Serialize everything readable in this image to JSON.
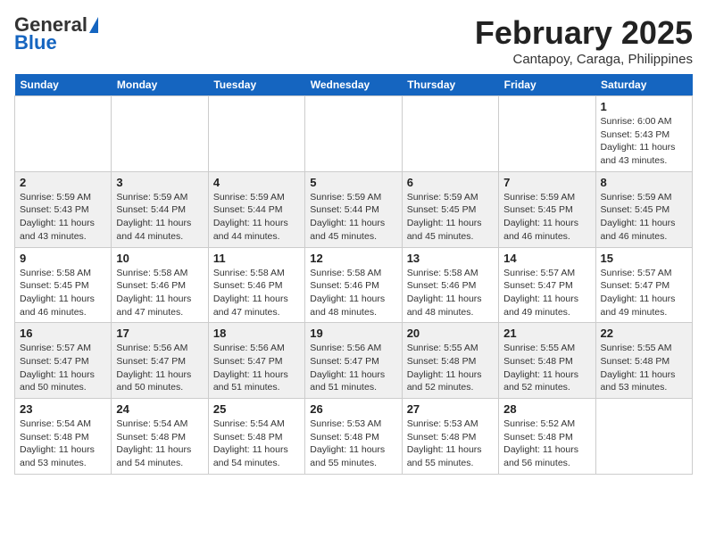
{
  "header": {
    "logo_general": "General",
    "logo_blue": "Blue",
    "month": "February 2025",
    "location": "Cantapoy, Caraga, Philippines"
  },
  "days_of_week": [
    "Sunday",
    "Monday",
    "Tuesday",
    "Wednesday",
    "Thursday",
    "Friday",
    "Saturday"
  ],
  "weeks": [
    [
      {
        "day": "",
        "info": ""
      },
      {
        "day": "",
        "info": ""
      },
      {
        "day": "",
        "info": ""
      },
      {
        "day": "",
        "info": ""
      },
      {
        "day": "",
        "info": ""
      },
      {
        "day": "",
        "info": ""
      },
      {
        "day": "1",
        "info": "Sunrise: 6:00 AM\nSunset: 5:43 PM\nDaylight: 11 hours\nand 43 minutes."
      }
    ],
    [
      {
        "day": "2",
        "info": "Sunrise: 5:59 AM\nSunset: 5:43 PM\nDaylight: 11 hours\nand 43 minutes."
      },
      {
        "day": "3",
        "info": "Sunrise: 5:59 AM\nSunset: 5:44 PM\nDaylight: 11 hours\nand 44 minutes."
      },
      {
        "day": "4",
        "info": "Sunrise: 5:59 AM\nSunset: 5:44 PM\nDaylight: 11 hours\nand 44 minutes."
      },
      {
        "day": "5",
        "info": "Sunrise: 5:59 AM\nSunset: 5:44 PM\nDaylight: 11 hours\nand 45 minutes."
      },
      {
        "day": "6",
        "info": "Sunrise: 5:59 AM\nSunset: 5:45 PM\nDaylight: 11 hours\nand 45 minutes."
      },
      {
        "day": "7",
        "info": "Sunrise: 5:59 AM\nSunset: 5:45 PM\nDaylight: 11 hours\nand 46 minutes."
      },
      {
        "day": "8",
        "info": "Sunrise: 5:59 AM\nSunset: 5:45 PM\nDaylight: 11 hours\nand 46 minutes."
      }
    ],
    [
      {
        "day": "9",
        "info": "Sunrise: 5:58 AM\nSunset: 5:45 PM\nDaylight: 11 hours\nand 46 minutes."
      },
      {
        "day": "10",
        "info": "Sunrise: 5:58 AM\nSunset: 5:46 PM\nDaylight: 11 hours\nand 47 minutes."
      },
      {
        "day": "11",
        "info": "Sunrise: 5:58 AM\nSunset: 5:46 PM\nDaylight: 11 hours\nand 47 minutes."
      },
      {
        "day": "12",
        "info": "Sunrise: 5:58 AM\nSunset: 5:46 PM\nDaylight: 11 hours\nand 48 minutes."
      },
      {
        "day": "13",
        "info": "Sunrise: 5:58 AM\nSunset: 5:46 PM\nDaylight: 11 hours\nand 48 minutes."
      },
      {
        "day": "14",
        "info": "Sunrise: 5:57 AM\nSunset: 5:47 PM\nDaylight: 11 hours\nand 49 minutes."
      },
      {
        "day": "15",
        "info": "Sunrise: 5:57 AM\nSunset: 5:47 PM\nDaylight: 11 hours\nand 49 minutes."
      }
    ],
    [
      {
        "day": "16",
        "info": "Sunrise: 5:57 AM\nSunset: 5:47 PM\nDaylight: 11 hours\nand 50 minutes."
      },
      {
        "day": "17",
        "info": "Sunrise: 5:56 AM\nSunset: 5:47 PM\nDaylight: 11 hours\nand 50 minutes."
      },
      {
        "day": "18",
        "info": "Sunrise: 5:56 AM\nSunset: 5:47 PM\nDaylight: 11 hours\nand 51 minutes."
      },
      {
        "day": "19",
        "info": "Sunrise: 5:56 AM\nSunset: 5:47 PM\nDaylight: 11 hours\nand 51 minutes."
      },
      {
        "day": "20",
        "info": "Sunrise: 5:55 AM\nSunset: 5:48 PM\nDaylight: 11 hours\nand 52 minutes."
      },
      {
        "day": "21",
        "info": "Sunrise: 5:55 AM\nSunset: 5:48 PM\nDaylight: 11 hours\nand 52 minutes."
      },
      {
        "day": "22",
        "info": "Sunrise: 5:55 AM\nSunset: 5:48 PM\nDaylight: 11 hours\nand 53 minutes."
      }
    ],
    [
      {
        "day": "23",
        "info": "Sunrise: 5:54 AM\nSunset: 5:48 PM\nDaylight: 11 hours\nand 53 minutes."
      },
      {
        "day": "24",
        "info": "Sunrise: 5:54 AM\nSunset: 5:48 PM\nDaylight: 11 hours\nand 54 minutes."
      },
      {
        "day": "25",
        "info": "Sunrise: 5:54 AM\nSunset: 5:48 PM\nDaylight: 11 hours\nand 54 minutes."
      },
      {
        "day": "26",
        "info": "Sunrise: 5:53 AM\nSunset: 5:48 PM\nDaylight: 11 hours\nand 55 minutes."
      },
      {
        "day": "27",
        "info": "Sunrise: 5:53 AM\nSunset: 5:48 PM\nDaylight: 11 hours\nand 55 minutes."
      },
      {
        "day": "28",
        "info": "Sunrise: 5:52 AM\nSunset: 5:48 PM\nDaylight: 11 hours\nand 56 minutes."
      },
      {
        "day": "",
        "info": ""
      }
    ]
  ]
}
